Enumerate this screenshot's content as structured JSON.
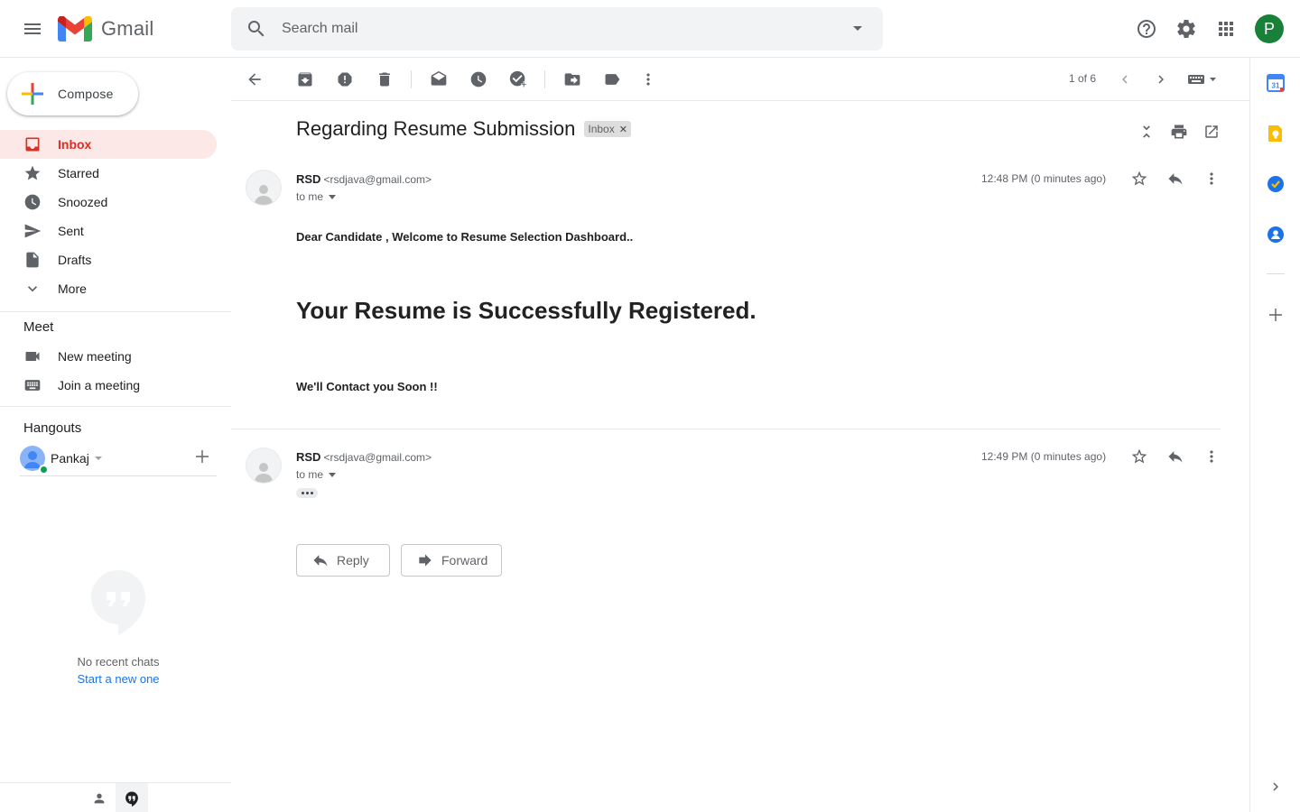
{
  "header": {
    "app_name": "Gmail",
    "search_placeholder": "Search mail",
    "avatar_letter": "P",
    "avatar_color": "#188038"
  },
  "sidebar": {
    "compose_label": "Compose",
    "items": [
      {
        "label": "Inbox",
        "icon": "inbox-icon",
        "active": true
      },
      {
        "label": "Starred",
        "icon": "star-icon"
      },
      {
        "label": "Snoozed",
        "icon": "clock-icon"
      },
      {
        "label": "Sent",
        "icon": "send-icon"
      },
      {
        "label": "Drafts",
        "icon": "draft-icon"
      },
      {
        "label": "More",
        "icon": "chevron-down-icon"
      }
    ],
    "meet": {
      "title": "Meet",
      "items": [
        {
          "label": "New meeting",
          "icon": "video-icon"
        },
        {
          "label": "Join a meeting",
          "icon": "keyboard-icon"
        }
      ]
    },
    "hangouts": {
      "title": "Hangouts",
      "user_name": "Pankaj",
      "no_chats": "No recent chats",
      "start_new": "Start a new one"
    }
  },
  "toolbar": {
    "pager": "1 of 6"
  },
  "thread": {
    "subject": "Regarding Resume Submission",
    "label": "Inbox",
    "messages": [
      {
        "sender_name": "RSD",
        "sender_email": "<rsdjava@gmail.com>",
        "recipient": "to me",
        "time": "12:48 PM (0 minutes ago)",
        "body_greeting": "Dear Candidate , Welcome to Resume Selection Dashboard..",
        "body_heading": "Your Resume is Successfully Registered.",
        "body_closing": "We'll Contact you Soon !!"
      },
      {
        "sender_name": "RSD",
        "sender_email": "<rsdjava@gmail.com>",
        "recipient": "to me",
        "time": "12:49 PM (0 minutes ago)"
      }
    ],
    "reply_label": "Reply",
    "forward_label": "Forward"
  },
  "colors": {
    "accent_red": "#d93025",
    "active_bg": "#fce8e6",
    "link_blue": "#1a73e8"
  }
}
